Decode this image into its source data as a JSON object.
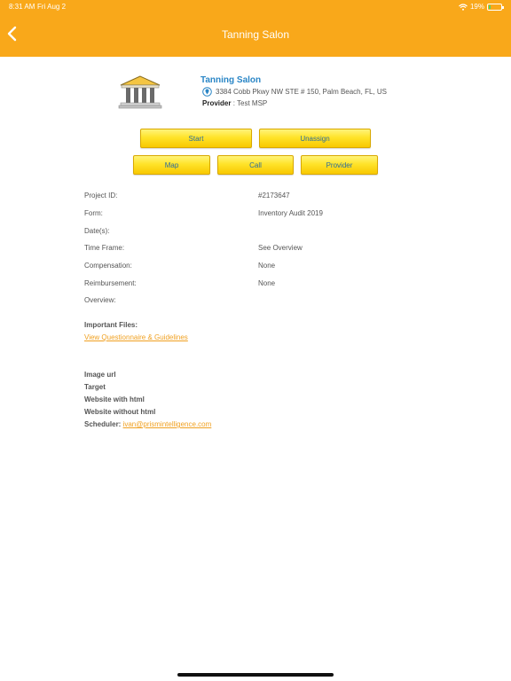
{
  "status_bar": {
    "time": "8:31 AM",
    "date": "Fri Aug 2",
    "battery": "19%",
    "battery_level": 0.19
  },
  "nav": {
    "title": "Tanning Salon"
  },
  "location": {
    "name": "Tanning Salon",
    "address": "3384 Cobb Pkwy NW STE # 150, Palm Beach, FL, US",
    "provider_label": "Provider",
    "provider_value": ": Test MSP"
  },
  "buttons": {
    "start": "Start",
    "unassign": "Unassign",
    "map": "Map",
    "call": "Call",
    "provider": "Provider"
  },
  "details": [
    {
      "label": "Project ID:",
      "value": "#2173647"
    },
    {
      "label": "Form:",
      "value": "Inventory Audit 2019"
    },
    {
      "label": "Date(s):",
      "value": ""
    },
    {
      "label": "Time Frame:",
      "value": "See Overview"
    },
    {
      "label": "Compensation:",
      "value": "None"
    },
    {
      "label": "Reimbursement:",
      "value": "None"
    },
    {
      "label": "Overview:",
      "value": ""
    }
  ],
  "files": {
    "title": "Important Files:",
    "link": "View Questionnaire & Guidelines"
  },
  "extra": {
    "image_url": "Image url",
    "target": "Target",
    "website_with_html": "Website with html",
    "website_without_html": "Website without html",
    "scheduler_label": "Scheduler:",
    "scheduler_email": "ivan@prismintelligence.com"
  }
}
